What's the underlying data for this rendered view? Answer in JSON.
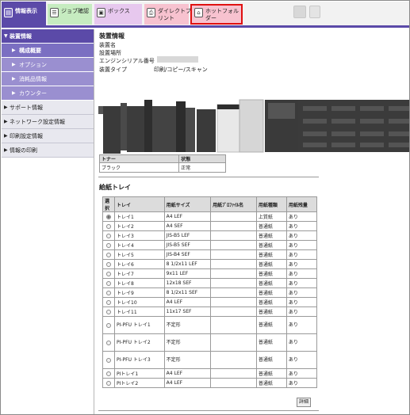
{
  "tabs": {
    "info": "情報表示",
    "job": "ジョブ確認",
    "box": "ボックス",
    "direct_print": "ダイレクトプ\nリント",
    "hot_folder": "ホットフォル\nダー"
  },
  "sidebar": {
    "items": [
      {
        "label": "装置情報",
        "kind": "open"
      },
      {
        "label": "構成概要",
        "kind": "sub-sel"
      },
      {
        "label": "オプション",
        "kind": "sub"
      },
      {
        "label": "消耗品情報",
        "kind": "sub"
      },
      {
        "label": "カウンター",
        "kind": "sub"
      },
      {
        "label": "サポート情報",
        "kind": "cat"
      },
      {
        "label": "ネットワーク設定情報",
        "kind": "cat"
      },
      {
        "label": "印刷設定情報",
        "kind": "cat"
      },
      {
        "label": "情報の印刷",
        "kind": "cat"
      }
    ]
  },
  "device": {
    "heading": "装置情報",
    "name_label": "装置名",
    "location_label": "設置場所",
    "serial_label": "エンジンシリアル番号",
    "type_label": "装置タイプ",
    "type_value": "印刷/コピー/スキャン"
  },
  "toner": {
    "headers": [
      "トナー",
      "状態"
    ],
    "rows": [
      [
        "ブラック",
        "正常"
      ]
    ]
  },
  "trays": {
    "heading": "給紙トレイ",
    "headers": [
      "選択",
      "トレイ",
      "用紙サイズ",
      "用紙ﾌﾟﾛﾌｧｲﾙ名",
      "用紙種類",
      "用紙残量"
    ],
    "rows": [
      {
        "tray": "トレイ1",
        "size": "A4 LEF",
        "profile": "",
        "type": "上質紙",
        "remaining": "あり",
        "selected": true
      },
      {
        "tray": "トレイ2",
        "size": "A4 SEF",
        "profile": "",
        "type": "普通紙",
        "remaining": "あり"
      },
      {
        "tray": "トレイ3",
        "size": "JIS-B5 LEF",
        "profile": "",
        "type": "普通紙",
        "remaining": "あり"
      },
      {
        "tray": "トレイ4",
        "size": "JIS-B5 SEF",
        "profile": "",
        "type": "普通紙",
        "remaining": "あり"
      },
      {
        "tray": "トレイ5",
        "size": "JIS-B4 SEF",
        "profile": "",
        "type": "普通紙",
        "remaining": "あり"
      },
      {
        "tray": "トレイ6",
        "size": "8 1/2x11 LEF",
        "profile": "",
        "type": "普通紙",
        "remaining": "あり"
      },
      {
        "tray": "トレイ7",
        "size": "9x11 LEF",
        "profile": "",
        "type": "普通紙",
        "remaining": "あり"
      },
      {
        "tray": "トレイ8",
        "size": "12x18 SEF",
        "profile": "",
        "type": "普通紙",
        "remaining": "あり"
      },
      {
        "tray": "トレイ9",
        "size": "8 1/2x11 SEF",
        "profile": "",
        "type": "普通紙",
        "remaining": "あり"
      },
      {
        "tray": "トレイ10",
        "size": "A4 LEF",
        "profile": "",
        "type": "普通紙",
        "remaining": "あり"
      },
      {
        "tray": "トレイ11",
        "size": "11x17 SEF",
        "profile": "",
        "type": "普通紙",
        "remaining": "あり"
      },
      {
        "tray": "PI-PFU トレイ1",
        "size": "不定形",
        "profile": "",
        "type": "普通紙",
        "remaining": "あり",
        "tall": true
      },
      {
        "tray": "PI-PFU トレイ2",
        "size": "不定形",
        "profile": "",
        "type": "普通紙",
        "remaining": "あり",
        "tall": true
      },
      {
        "tray": "PI-PFU トレイ3",
        "size": "不定形",
        "profile": "",
        "type": "普通紙",
        "remaining": "あり",
        "tall": true
      },
      {
        "tray": "PIトレイ1",
        "size": "A4 LEF",
        "profile": "",
        "type": "普通紙",
        "remaining": "あり"
      },
      {
        "tray": "PIトレイ2",
        "size": "A4 LEF",
        "profile": "",
        "type": "普通紙",
        "remaining": "あり"
      }
    ],
    "detail_button": "詳細"
  },
  "colors": {
    "accent": "#5b4aa8",
    "highlight_border": "#e01010"
  }
}
